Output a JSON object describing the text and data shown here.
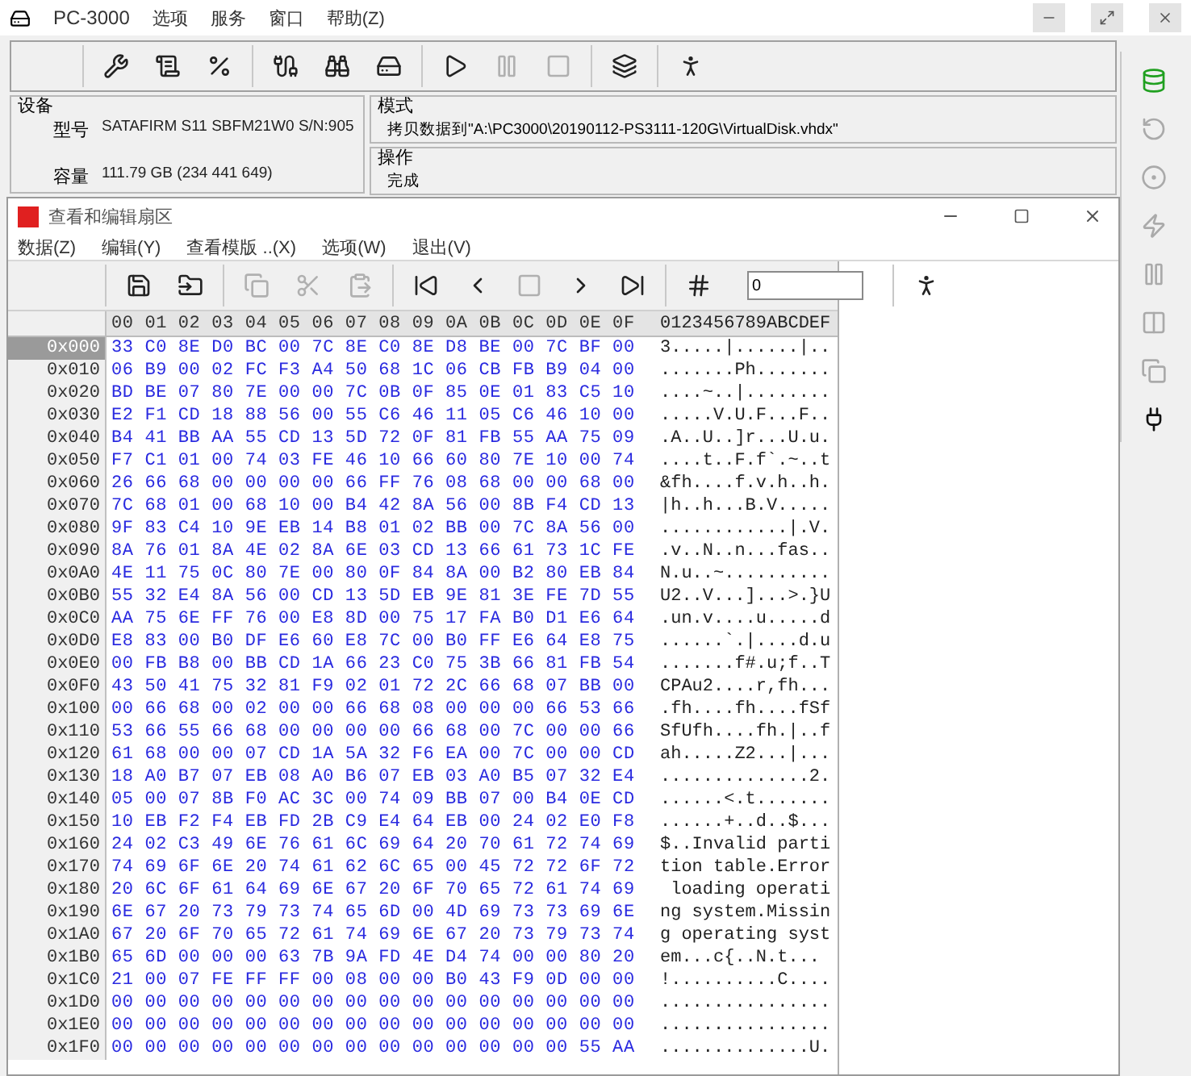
{
  "app": {
    "title": "PC-3000",
    "menu": [
      "选项",
      "服务",
      "窗口",
      "帮助(Z)"
    ]
  },
  "toolbar": [
    [
      {
        "kind": "tools",
        "disabled": false
      },
      {
        "kind": "scroll",
        "disabled": false
      },
      {
        "kind": "percent",
        "disabled": false
      }
    ],
    [
      {
        "kind": "probe",
        "disabled": false
      },
      {
        "kind": "binoculars",
        "disabled": false
      },
      {
        "kind": "disk",
        "disabled": false
      }
    ],
    [
      {
        "kind": "play",
        "disabled": false
      },
      {
        "kind": "pause",
        "disabled": true
      },
      {
        "kind": "stop",
        "disabled": true
      }
    ],
    [
      {
        "kind": "windows",
        "disabled": false
      }
    ],
    [
      {
        "kind": "exit",
        "disabled": false
      }
    ]
  ],
  "device": {
    "title": "设备",
    "model_label": "型号",
    "model": "SATAFIRM   S11 SBFM21W0 S/N:905",
    "capacity_label": "容量",
    "capacity": "111.79 GB (234 441 649)"
  },
  "mode": {
    "title": "模式",
    "text": "拷贝数据到\"A:\\PC3000\\20190112-PS3111-120G\\VirtualDisk.vhdx\""
  },
  "operation": {
    "title": "操作",
    "text": "完成"
  },
  "side_tools": [
    {
      "kind": "copy-disk",
      "disabled": false
    },
    {
      "kind": "reset",
      "disabled": true
    },
    {
      "kind": "zero",
      "disabled": true
    },
    {
      "kind": "probe",
      "disabled": true
    },
    {
      "kind": "pause",
      "disabled": true
    },
    {
      "kind": "split",
      "disabled": true
    },
    {
      "kind": "clone",
      "disabled": true
    },
    {
      "kind": "connect",
      "disabled": false
    }
  ],
  "editor": {
    "title": "查看和编辑扇区",
    "menu": [
      "数据(Z)",
      "编辑(Y)",
      "查看模版 ..(X)",
      "选项(W)",
      "退出(V)"
    ],
    "toolbar": [
      [
        {
          "kind": "save",
          "disabled": false
        },
        {
          "kind": "load",
          "disabled": false
        }
      ],
      [
        {
          "kind": "copy",
          "disabled": true
        },
        {
          "kind": "cut",
          "disabled": true
        },
        {
          "kind": "paste",
          "disabled": true
        }
      ],
      [
        {
          "kind": "first",
          "disabled": false
        },
        {
          "kind": "prev",
          "disabled": false
        },
        {
          "kind": "stop",
          "disabled": true
        },
        {
          "kind": "next",
          "disabled": false
        },
        {
          "kind": "last",
          "disabled": false
        }
      ],
      [
        {
          "kind": "goto",
          "disabled": false
        }
      ]
    ],
    "goto_value": "0",
    "exit_button": {
      "kind": "exit",
      "disabled": false
    },
    "header": {
      "hex": [
        "00",
        "01",
        "02",
        "03",
        "04",
        "05",
        "06",
        "07",
        "08",
        "09",
        "0A",
        "0B",
        "0C",
        "0D",
        "0E",
        "0F"
      ],
      "ascii": "0123456789ABCDEF"
    },
    "rows": [
      {
        "offset": "0x000",
        "hex": "33 C0 8E D0 BC 00 7C 8E C0 8E D8 BE 00 7C BF 00",
        "ascii": "3.....|......|..",
        "selected": true
      },
      {
        "offset": "0x010",
        "hex": "06 B9 00 02 FC F3 A4 50 68 1C 06 CB FB B9 04 00",
        "ascii": ".......Ph.......",
        "selected": false
      },
      {
        "offset": "0x020",
        "hex": "BD BE 07 80 7E 00 00 7C 0B 0F 85 0E 01 83 C5 10",
        "ascii": "....~..|........",
        "selected": false
      },
      {
        "offset": "0x030",
        "hex": "E2 F1 CD 18 88 56 00 55 C6 46 11 05 C6 46 10 00",
        "ascii": ".....V.U.F...F..",
        "selected": false
      },
      {
        "offset": "0x040",
        "hex": "B4 41 BB AA 55 CD 13 5D 72 0F 81 FB 55 AA 75 09",
        "ascii": ".A..U..]r...U.u.",
        "selected": false
      },
      {
        "offset": "0x050",
        "hex": "F7 C1 01 00 74 03 FE 46 10 66 60 80 7E 10 00 74",
        "ascii": "....t..F.f`.~..t",
        "selected": false
      },
      {
        "offset": "0x060",
        "hex": "26 66 68 00 00 00 00 66 FF 76 08 68 00 00 68 00",
        "ascii": "&fh....f.v.h..h.",
        "selected": false
      },
      {
        "offset": "0x070",
        "hex": "7C 68 01 00 68 10 00 B4 42 8A 56 00 8B F4 CD 13",
        "ascii": "|h..h...B.V.....",
        "selected": false
      },
      {
        "offset": "0x080",
        "hex": "9F 83 C4 10 9E EB 14 B8 01 02 BB 00 7C 8A 56 00",
        "ascii": "............|.V.",
        "selected": false
      },
      {
        "offset": "0x090",
        "hex": "8A 76 01 8A 4E 02 8A 6E 03 CD 13 66 61 73 1C FE",
        "ascii": ".v..N..n...fas..",
        "selected": false
      },
      {
        "offset": "0x0A0",
        "hex": "4E 11 75 0C 80 7E 00 80 0F 84 8A 00 B2 80 EB 84",
        "ascii": "N.u..~..........",
        "selected": false
      },
      {
        "offset": "0x0B0",
        "hex": "55 32 E4 8A 56 00 CD 13 5D EB 9E 81 3E FE 7D 55",
        "ascii": "U2..V...]...>.}U",
        "selected": false
      },
      {
        "offset": "0x0C0",
        "hex": "AA 75 6E FF 76 00 E8 8D 00 75 17 FA B0 D1 E6 64",
        "ascii": ".un.v....u.....d",
        "selected": false
      },
      {
        "offset": "0x0D0",
        "hex": "E8 83 00 B0 DF E6 60 E8 7C 00 B0 FF E6 64 E8 75",
        "ascii": "......`.|....d.u",
        "selected": false
      },
      {
        "offset": "0x0E0",
        "hex": "00 FB B8 00 BB CD 1A 66 23 C0 75 3B 66 81 FB 54",
        "ascii": ".......f#.u;f..T",
        "selected": false
      },
      {
        "offset": "0x0F0",
        "hex": "43 50 41 75 32 81 F9 02 01 72 2C 66 68 07 BB 00",
        "ascii": "CPAu2....r,fh...",
        "selected": false
      },
      {
        "offset": "0x100",
        "hex": "00 66 68 00 02 00 00 66 68 08 00 00 00 66 53 66",
        "ascii": ".fh....fh....fSf",
        "selected": false
      },
      {
        "offset": "0x110",
        "hex": "53 66 55 66 68 00 00 00 00 66 68 00 7C 00 00 66",
        "ascii": "SfUfh....fh.|..f",
        "selected": false
      },
      {
        "offset": "0x120",
        "hex": "61 68 00 00 07 CD 1A 5A 32 F6 EA 00 7C 00 00 CD",
        "ascii": "ah.....Z2...|...",
        "selected": false
      },
      {
        "offset": "0x130",
        "hex": "18 A0 B7 07 EB 08 A0 B6 07 EB 03 A0 B5 07 32 E4",
        "ascii": "..............2.",
        "selected": false
      },
      {
        "offset": "0x140",
        "hex": "05 00 07 8B F0 AC 3C 00 74 09 BB 07 00 B4 0E CD",
        "ascii": "......<.t.......",
        "selected": false
      },
      {
        "offset": "0x150",
        "hex": "10 EB F2 F4 EB FD 2B C9 E4 64 EB 00 24 02 E0 F8",
        "ascii": "......+..d..$...",
        "selected": false
      },
      {
        "offset": "0x160",
        "hex": "24 02 C3 49 6E 76 61 6C 69 64 20 70 61 72 74 69",
        "ascii": "$..Invalid parti",
        "selected": false
      },
      {
        "offset": "0x170",
        "hex": "74 69 6F 6E 20 74 61 62 6C 65 00 45 72 72 6F 72",
        "ascii": "tion table.Error",
        "selected": false
      },
      {
        "offset": "0x180",
        "hex": "20 6C 6F 61 64 69 6E 67 20 6F 70 65 72 61 74 69",
        "ascii": " loading operati",
        "selected": false
      },
      {
        "offset": "0x190",
        "hex": "6E 67 20 73 79 73 74 65 6D 00 4D 69 73 73 69 6E",
        "ascii": "ng system.Missin",
        "selected": false
      },
      {
        "offset": "0x1A0",
        "hex": "67 20 6F 70 65 72 61 74 69 6E 67 20 73 79 73 74",
        "ascii": "g operating syst",
        "selected": false
      },
      {
        "offset": "0x1B0",
        "hex": "65 6D 00 00 00 63 7B 9A FD 4E D4 74 00 00 80 20",
        "ascii": "em...c{..N.t...",
        "selected": false
      },
      {
        "offset": "0x1C0",
        "hex": "21 00 07 FE FF FF 00 08 00 00 B0 43 F9 0D 00 00",
        "ascii": "!..........C....",
        "selected": false
      },
      {
        "offset": "0x1D0",
        "hex": "00 00 00 00 00 00 00 00 00 00 00 00 00 00 00 00",
        "ascii": "................",
        "selected": false
      },
      {
        "offset": "0x1E0",
        "hex": "00 00 00 00 00 00 00 00 00 00 00 00 00 00 00 00",
        "ascii": "................",
        "selected": false
      },
      {
        "offset": "0x1F0",
        "hex": "00 00 00 00 00 00 00 00 00 00 00 00 00 00 55 AA",
        "ascii": "..............U.",
        "selected": false
      }
    ]
  }
}
